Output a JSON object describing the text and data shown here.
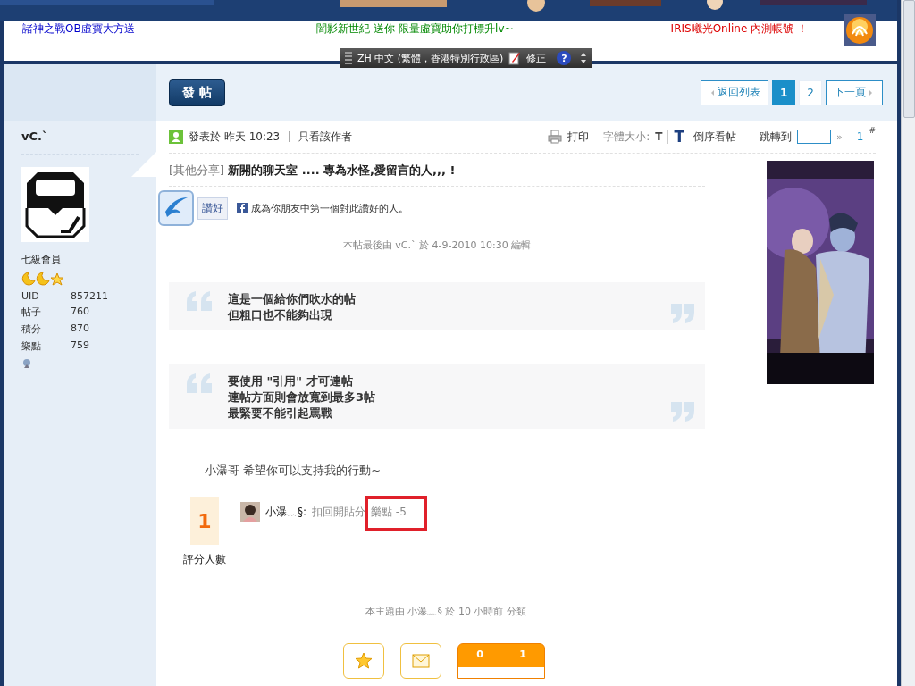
{
  "ads": [
    {
      "text": "諸神之戰OB虛寶大方送",
      "color": "#0000cc"
    },
    {
      "text": "闇影新世紀 送你 限量虛寶助你打標升lv~",
      "color": "#008800"
    },
    {
      "text": "IRIS曦光Online 內測帳號 ！",
      "color": "#dd0000"
    }
  ],
  "ime_bar": {
    "language": "ZH 中文 (繁體，香港特別行政區)",
    "correct": "修正",
    "help": "?"
  },
  "post_button": "發 帖",
  "pagination": {
    "back": "返回列表",
    "pages": [
      {
        "label": "1",
        "selected": true
      },
      {
        "label": "2",
        "selected": false
      }
    ],
    "next": "下一頁"
  },
  "author": {
    "name": "vC.`",
    "rank": "七級會員",
    "stats": [
      {
        "label": "UID",
        "value": "857211"
      },
      {
        "label": "帖子",
        "value": "760"
      },
      {
        "label": "積分",
        "value": "870"
      },
      {
        "label": "樂點",
        "value": "759"
      }
    ]
  },
  "post_meta": {
    "posted": "發表於 昨天 10:23",
    "author_only": "只看該作者",
    "print": "打印",
    "font_size_label": "字體大小:",
    "font_small": "T",
    "font_large": "T",
    "reverse": "倒序看帖",
    "jump_label": "跳轉到",
    "jump_go": "»",
    "floor": "1",
    "floor_mark": "#"
  },
  "title": {
    "category": "[其他分享]",
    "text": "新開的聊天室 .... 專為水怪,愛留言的人,,, !"
  },
  "like": {
    "button": "讚好",
    "text": "成為你朋友中第一個對此讚好的人。"
  },
  "edit_note": "本帖最後由 vC.` 於 4-9-2010 10:30 編輯",
  "quotes": [
    {
      "lines": [
        "這是一個給你們吹水的帖",
        "但粗口也不能夠出現"
      ]
    },
    {
      "lines": [
        "要使用 \"引用\" 才可連帖",
        "連帖方面則會放寬到最多3帖",
        "最緊要不能引起罵戰"
      ]
    }
  ],
  "message": "小瀑哥 希望你可以支持我的行動~",
  "rating": {
    "count": "1",
    "count_label": "評分人數",
    "entries": [
      {
        "user": "小瀑﹏§:",
        "action": "扣回開貼分",
        "reward": "樂點 -5",
        "highlighted": true
      }
    ]
  },
  "moderation_note": "本主題由 小瀑﹏§ 於 10 小時前 分類",
  "actions": {
    "counts": [
      "0",
      "1"
    ]
  }
}
